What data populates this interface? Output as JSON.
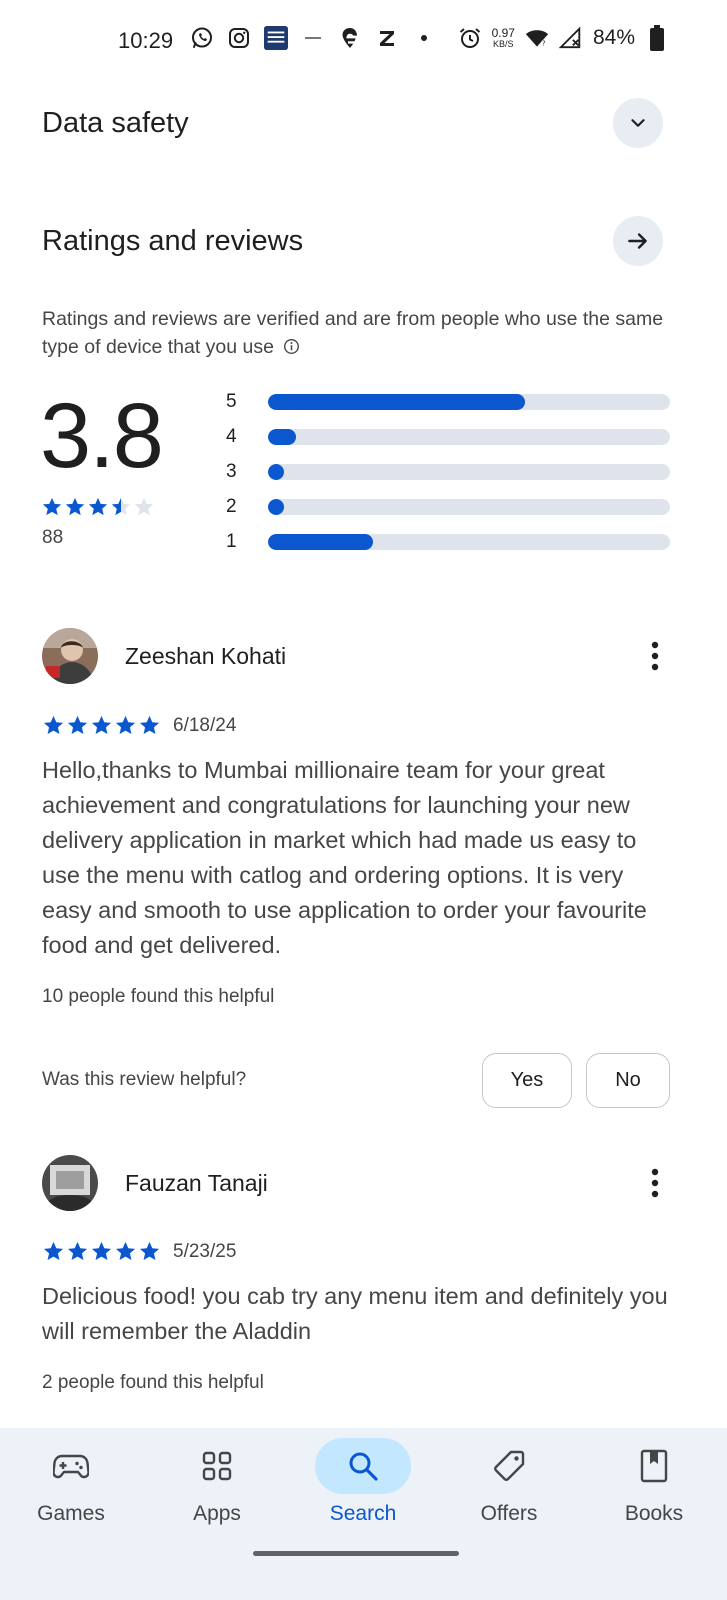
{
  "status_bar": {
    "time": "10:29",
    "net_speed_value": "0.97",
    "net_speed_unit": "KB/S",
    "battery": "84%",
    "icons": [
      "whatsapp-icon",
      "instagram-icon",
      "stockedge-icon",
      "app-icon",
      "swiggy-icon",
      "zomato-icon",
      "dot-icon",
      "alarm-icon",
      "wifi-icon",
      "signal-icon",
      "battery-icon"
    ]
  },
  "data_safety": {
    "title": "Data safety",
    "icon": "chevron-down-icon"
  },
  "ratings": {
    "title": "Ratings and reviews",
    "icon": "arrow-right-icon",
    "description": "Ratings and reviews are verified and are from people who use the same type of device that you use",
    "score": "3.8",
    "stars": 3.5,
    "count": "88",
    "distribution": [
      {
        "label": "5",
        "fraction": 0.64
      },
      {
        "label": "4",
        "fraction": 0.07
      },
      {
        "label": "3",
        "fraction": 0.04
      },
      {
        "label": "2",
        "fraction": 0.04
      },
      {
        "label": "1",
        "fraction": 0.26
      }
    ],
    "accent": "#0b57d0",
    "track": "#dfe3eb"
  },
  "reviews": [
    {
      "name": "Zeeshan Kohati",
      "stars": 5,
      "date": "6/18/24",
      "text": "Hello,thanks to Mumbai millionaire team for your great achievement and congratulations for launching your new delivery application in market which had made us easy to use the menu with catlog and ordering options. It is very easy and smooth to use application to order your favourite food and get delivered.",
      "helpful": "10 people found this helpful"
    },
    {
      "name": "Fauzan Tanaji",
      "stars": 5,
      "date": "5/23/25",
      "text": "Delicious food! you cab try any menu item and definitely you will remember the Aladdin",
      "helpful": "2 people found this helpful"
    }
  ],
  "helpful_prompt": {
    "question": "Was this review helpful?",
    "yes": "Yes",
    "no": "No"
  },
  "bottom_nav": [
    {
      "label": "Games",
      "icon": "gamepad-icon",
      "active": false
    },
    {
      "label": "Apps",
      "icon": "apps-grid-icon",
      "active": false
    },
    {
      "label": "Search",
      "icon": "search-icon",
      "active": true
    },
    {
      "label": "Offers",
      "icon": "tag-icon",
      "active": false
    },
    {
      "label": "Books",
      "icon": "bookmark-book-icon",
      "active": false
    }
  ]
}
